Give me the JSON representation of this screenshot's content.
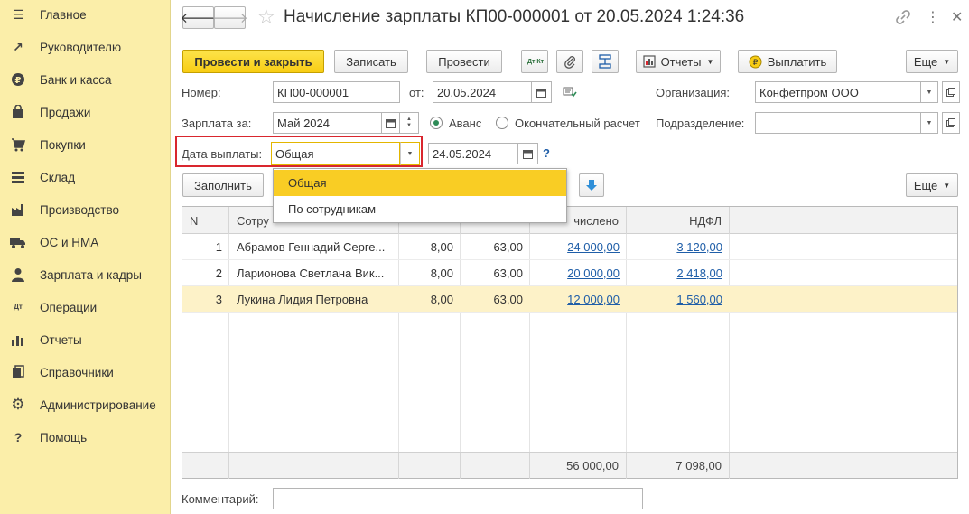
{
  "sidebar": {
    "items": [
      {
        "label": "Главное",
        "icon": "menu-icon"
      },
      {
        "label": "Руководителю",
        "icon": "trend-icon"
      },
      {
        "label": "Банк и касса",
        "icon": "coin-icon"
      },
      {
        "label": "Продажи",
        "icon": "bag-icon"
      },
      {
        "label": "Покупки",
        "icon": "cart-icon"
      },
      {
        "label": "Склад",
        "icon": "warehouse-icon"
      },
      {
        "label": "Производство",
        "icon": "factory-icon"
      },
      {
        "label": "ОС и НМА",
        "icon": "truck-icon"
      },
      {
        "label": "Зарплата и кадры",
        "icon": "person-icon"
      },
      {
        "label": "Операции",
        "icon": "dt-kt-icon"
      },
      {
        "label": "Отчеты",
        "icon": "bar-chart-icon"
      },
      {
        "label": "Справочники",
        "icon": "books-icon"
      },
      {
        "label": "Администрирование",
        "icon": "gear-icon"
      },
      {
        "label": "Помощь",
        "icon": "help-icon"
      }
    ],
    "icon_glyphs": [
      "☰",
      "↗",
      "₽",
      "▮",
      "🛒",
      "▦",
      "▟",
      "▬",
      "●",
      "Дт",
      "▂",
      "▤",
      "⚙",
      "?"
    ]
  },
  "window": {
    "title": "Начисление зарплаты КП00-000001 от 20.05.2024 1:24:36",
    "back": "🡐",
    "forward": "🡒",
    "star": "☆",
    "link_icon": "🔗",
    "more_icon": "⋮",
    "close_icon": "✕"
  },
  "toolbar": {
    "post_close": "Провести и закрыть",
    "save": "Записать",
    "post": "Провести",
    "dtkt": "Дт Кт",
    "reports": "Отчеты",
    "pay": "Выплатить",
    "more": "Еще"
  },
  "form": {
    "number_label": "Номер:",
    "number_value": "КП00-000001",
    "date_label": "от:",
    "date_value": "20.05.2024",
    "org_label": "Организация:",
    "org_value": "Конфетпром ООО",
    "salary_for_label": "Зарплата за:",
    "salary_for_value": "Май 2024",
    "advance_label": "Аванс",
    "final_label": "Окончательный расчет",
    "division_label": "Подразделение:",
    "division_value": "",
    "pay_date_label": "Дата выплаты:",
    "pay_date_type": "Общая",
    "pay_date_value": "24.05.2024",
    "help": "?"
  },
  "dropdown": {
    "options": [
      "Общая",
      "По сотрудникам"
    ],
    "selected_index": 0
  },
  "table_toolbar": {
    "fill": "Заполнить",
    "more": "Еще"
  },
  "table": {
    "headers": [
      "N",
      "Сотру",
      "",
      "",
      "Начислено",
      "НДФЛ"
    ],
    "header_accrued_visible": "числено",
    "rows": [
      {
        "n": "1",
        "employee": "Абрамов Геннадий Серге...",
        "c3": "8,00",
        "c4": "63,00",
        "accrued": "24 000,00",
        "ndfl": "3 120,00"
      },
      {
        "n": "2",
        "employee": "Ларионова Светлана Вик...",
        "c3": "8,00",
        "c4": "63,00",
        "accrued": "20 000,00",
        "ndfl": "2 418,00"
      },
      {
        "n": "3",
        "employee": "Лукина Лидия Петровна",
        "c3": "8,00",
        "c4": "63,00",
        "accrued": "12 000,00",
        "ndfl": "1 560,00"
      }
    ],
    "totals": {
      "accrued": "56 000,00",
      "ndfl": "7 098,00"
    }
  },
  "comment": {
    "label": "Комментарий:",
    "value": ""
  },
  "colors": {
    "sidebar_bg": "#fbeea9",
    "primary_btn": "#f8cd14",
    "highlight_border": "#d9262e",
    "selected_row": "#fdf2c8",
    "dropdown_selected": "#f9cd24",
    "link": "#1f5ea8",
    "radio_active": "#2e8b57"
  }
}
